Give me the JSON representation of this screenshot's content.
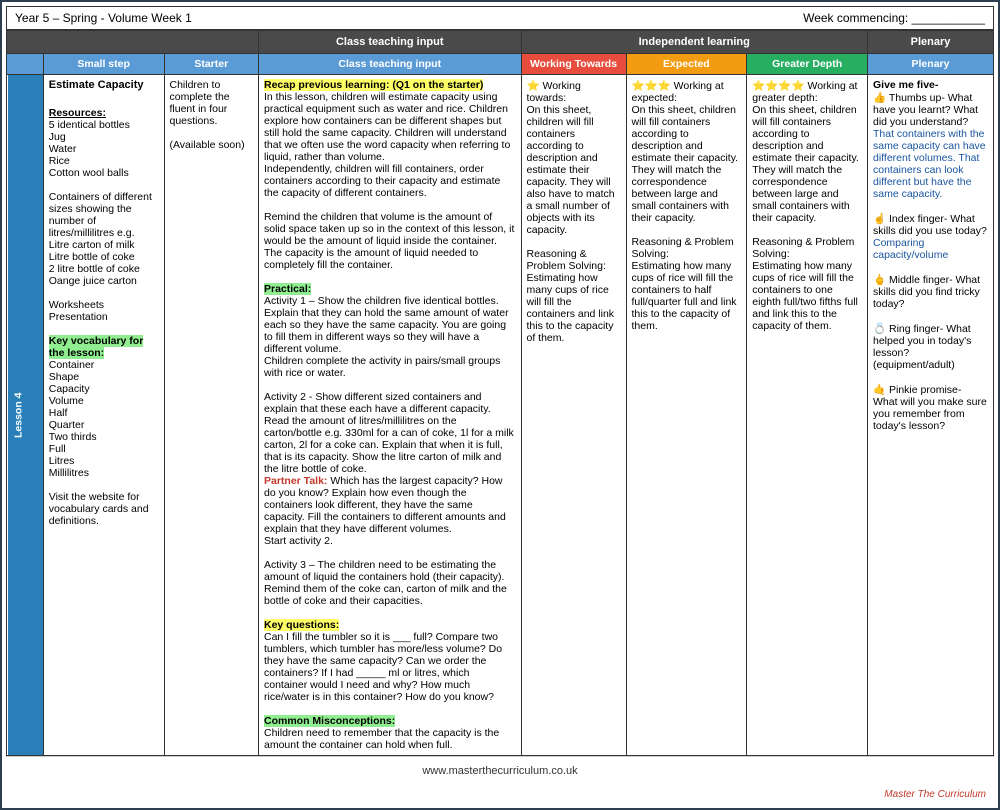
{
  "header": {
    "title": "Year 5 – Spring - Volume Week 1",
    "week_commencing": "Week commencing: ___________"
  },
  "columns": {
    "small_step": "Small step",
    "starter": "Starter",
    "class_input": "Class teaching input",
    "independent": "Independent learning",
    "plenary": "Plenary",
    "working_towards": "Working Towards",
    "expected": "Expected",
    "greater_depth": "Greater Depth"
  },
  "lesson": {
    "number": "Lesson 4",
    "small_step_title": "Estimate Capacity",
    "resources_label": "Resources:",
    "resources": [
      "5 identical bottles",
      "Jug",
      "Water",
      "Rice",
      "Cotton wool balls",
      "",
      "Containers of different sizes showing the number of litres/millilitres e.g.",
      "Litre carton of milk",
      "Litre bottle of coke",
      "2 litre bottle of coke",
      "Oange juice carton",
      "",
      "Worksheets",
      "Presentation"
    ],
    "vocab_label": "Key vocabulary for the lesson:",
    "vocab_list": [
      "Container",
      "Shape",
      "Capacity",
      "Volume",
      "Half",
      "Quarter",
      "Two thirds",
      "Full",
      "Litres",
      "Millilitres"
    ],
    "website_note": "Visit the website for vocabulary cards and definitions.",
    "starter_text": "Children to complete the fluent in four questions.\n\n(Available soon)",
    "class_input": {
      "recap_label": "Recap previous learning: (Q1 on the starter)",
      "intro": "In this lesson, children will estimate capacity using practical equipment such as water and rice. Children explore how containers can be different shapes but still hold the same capacity. Children will understand that we often use the word capacity when referring to liquid, rather than volume.\nIndependently, children will fill containers, order containers according to their capacity and estimate the capacity of different containers.",
      "remind": "Remind the children that volume is the amount of solid space taken up so in the context of this lesson, it would be the amount of liquid inside the container. The capacity is the amount of liquid needed to completely fill the container.",
      "practical_label": "Practical:",
      "activity1": "Activity 1 – Show the children five identical bottles. Explain that they can hold the same amount of water each so they have the same capacity. You are going to fill them in different ways so they will have a different volume.\nChildren complete the activity in pairs/small groups with rice or water.",
      "activity2": "Activity 2 - Show different sized containers and explain that these each have a different capacity. Read the amount of litres/millilitres on the carton/bottle e.g. 330ml for a can of coke, 1l for a milk carton, 2l for a coke can. Explain that when it is full, that is its capacity. Show the litre carton of milk and the litre bottle of coke.",
      "partner_talk_label": "Partner Talk:",
      "partner_talk": "Which has the largest capacity? How do you know? Explain how even though the containers look different, they have the same capacity. Fill the containers to different amounts and explain that they have different volumes.\nStart activity 2.",
      "activity3": "Activity 3 – The children need to be estimating the amount of liquid the containers hold (their capacity). Remind them of the coke can, carton of milk and the bottle of coke and their capacities.",
      "key_questions_label": "Key questions:",
      "key_questions": "Can I fill the tumbler so it is ___ full? Compare two tumblers, which tumbler has more/less volume? Do they have the same capacity? Can we order the containers? If I had _____ ml or litres, which container would I need and why? How much rice/water is in this container? How do you know?",
      "misconceptions_label": "Common Misconceptions:",
      "misconceptions": "Children need to remember that the capacity is the amount the container can hold when full."
    },
    "working_towards": {
      "stars": "⭐",
      "intro": "Working towards:\nOn this sheet, children will fill containers according to description and estimate their capacity. They will also have to match a small number of objects with its capacity.",
      "reasoning": "Reasoning & Problem Solving:\nEstimating how many cups of rice will fill the containers and link this to the capacity of them."
    },
    "expected": {
      "stars": "⭐⭐⭐",
      "intro": "Working at expected:\nOn this sheet, children will fill containers according to description and estimate their capacity. They will match the correspondence between large and small containers with their capacity.",
      "reasoning": "Reasoning & Problem Solving:\nEstimating how many cups of rice will fill the containers to half full/quarter full and link this to the capacity of them."
    },
    "greater_depth": {
      "stars": "⭐⭐⭐⭐",
      "intro": "Working at greater depth:\nOn this sheet, children will fill containers according to description and estimate their capacity. They will match the correspondence between large and small containers with their capacity.",
      "reasoning": "Reasoning & Problem Solving:\nEstimating how many cups of rice will fill the containers to one eighth full/two fifths full and link this to the capacity of them."
    },
    "plenary": {
      "title": "Give me five-",
      "thumbs": "👍 Thumbs up- What have you learnt? What did you understand?",
      "thumbs_blue": "That containers with the same capacity can have different volumes. That containers can look different but have the same capacity.",
      "index": "☝ Index finger- What skills did you use today?",
      "index_blue": "Comparing capacity/volume",
      "middle": "🖕 Middle finger- What skills did you find tricky today?",
      "ring": "💍 Ring finger- What helped you in today's lesson? (equipment/adult)",
      "pinkie": "🤙 Pinkie promise- What will you make sure you remember from today's lesson?"
    }
  },
  "footer": {
    "website": "www.masterthecurriculum.co.uk",
    "logo": "Master The Curriculum"
  }
}
